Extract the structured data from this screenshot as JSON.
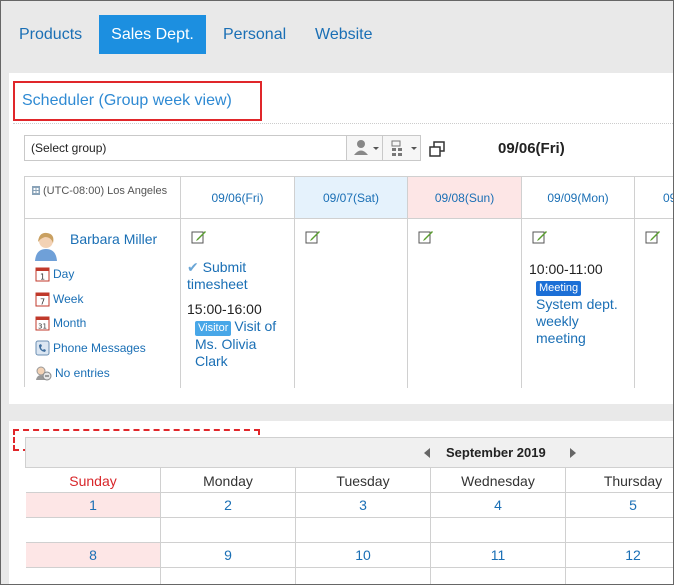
{
  "tabs": [
    {
      "label": "Products",
      "active": false
    },
    {
      "label": "Sales Dept.",
      "active": true
    },
    {
      "label": "Personal",
      "active": false
    },
    {
      "label": "Website",
      "active": false
    }
  ],
  "scheduler": {
    "title": "Scheduler (Group week view)",
    "group_select_value": "(Select group)",
    "current_date": "09/06(Fri)",
    "timezone": "(UTC-08:00) Los Angeles",
    "days": [
      {
        "label": "09/06(Fri)",
        "kind": "weekday"
      },
      {
        "label": "09/07(Sat)",
        "kind": "sat"
      },
      {
        "label": "09/08(Sun)",
        "kind": "sun"
      },
      {
        "label": "09/09(Mon)",
        "kind": "weekday"
      },
      {
        "label": "09/",
        "kind": "weekday"
      }
    ],
    "user": {
      "name": "Barbara Miller",
      "links": {
        "day": "Day",
        "week": "Week",
        "month": "Month",
        "phone": "Phone Messages",
        "entries": "No entries"
      }
    },
    "events": {
      "fri_todo": "Submit timesheet",
      "fri_time": "15:00-16:00",
      "fri_badge": "Visitor",
      "fri_title": "Visit of Ms. Olivia Clark",
      "mon_time": "10:00-11:00",
      "mon_badge": "Meeting",
      "mon_title": "System dept. weekly meeting"
    }
  },
  "calendar": {
    "month_label": "September 2019",
    "weekdays": [
      "Sunday",
      "Monday",
      "Tuesday",
      "Wednesday",
      "Thursday"
    ],
    "week1": [
      "1",
      "2",
      "3",
      "4",
      "5"
    ],
    "week2": [
      "8",
      "9",
      "10",
      "11",
      "12"
    ]
  },
  "colors": {
    "accent": "#1c8fe0",
    "link": "#1a6fb5",
    "highlight_border": "#e0262a",
    "saturday_bg": "#e5f2fc",
    "sunday_bg": "#fde6e6"
  }
}
